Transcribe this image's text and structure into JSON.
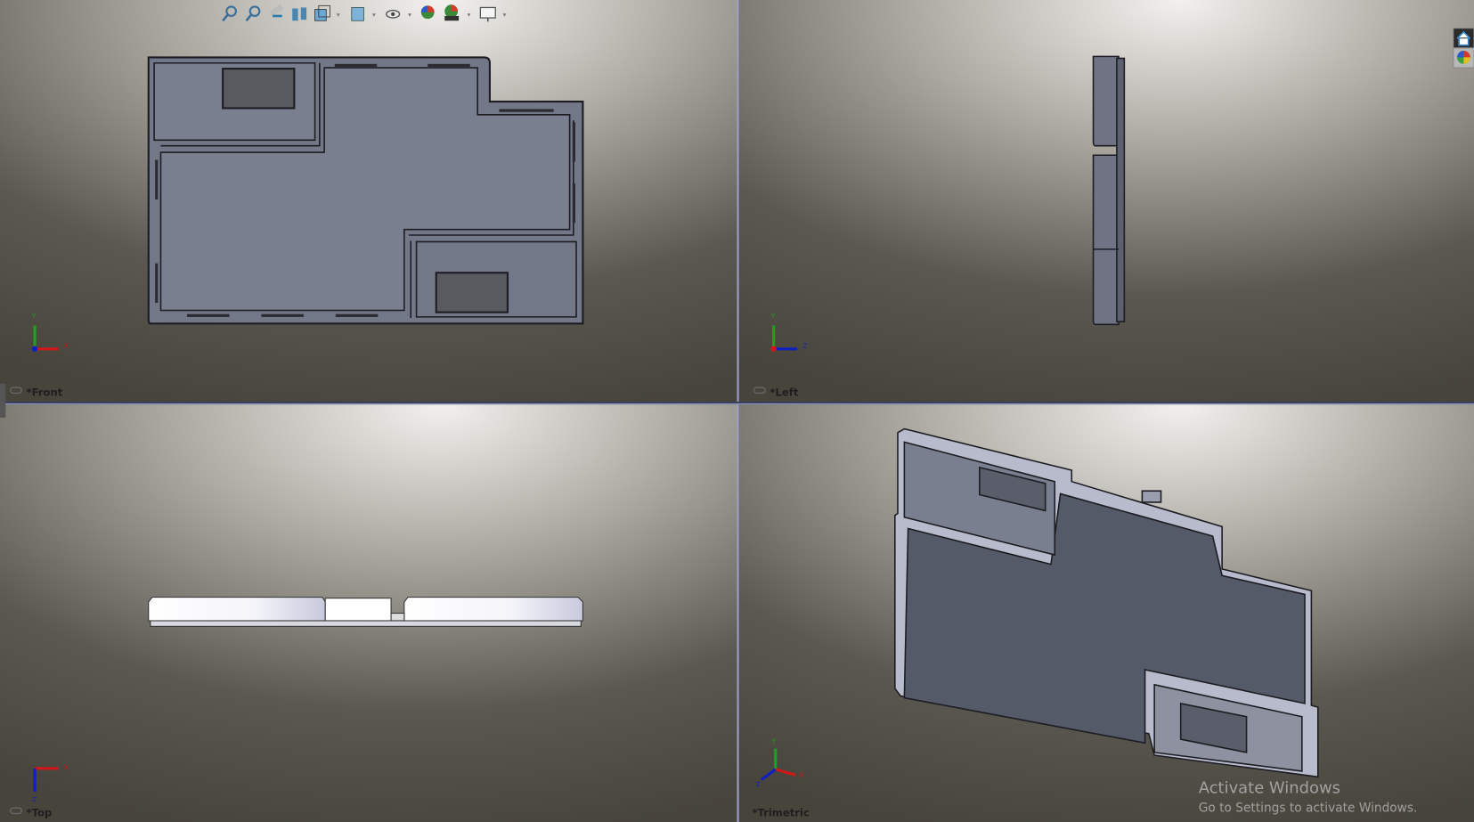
{
  "app": "SolidWorks",
  "toolbar": {
    "icons": [
      "zoom-to-fit-icon",
      "zoom-to-area-icon",
      "previous-view-icon",
      "section-view-icon",
      "view-orientation-icon",
      "display-style-icon",
      "hide-show-items-icon",
      "edit-appearance-icon",
      "apply-scene-icon",
      "view-settings-icon"
    ]
  },
  "task_pane": {
    "icons": [
      "home-icon",
      "appearances-icon"
    ]
  },
  "viewports": [
    {
      "label": "*Front",
      "axes": [
        "Y",
        "X"
      ]
    },
    {
      "label": "*Left",
      "axes": [
        "Y",
        "Z"
      ]
    },
    {
      "label": "*Top",
      "axes": [
        "X",
        "Z"
      ]
    },
    {
      "label": "*Trimetric",
      "axes": [
        "Y",
        "X",
        "Z"
      ]
    }
  ],
  "colors": {
    "part": "#6e7280",
    "part_light": "#c9cad6",
    "background_top": "#ecebe8",
    "background_bottom": "#4a4740",
    "divider": "#9aa0c8"
  },
  "watermark": {
    "title": "Activate Windows",
    "subtitle": "Go to Settings to activate Windows."
  }
}
